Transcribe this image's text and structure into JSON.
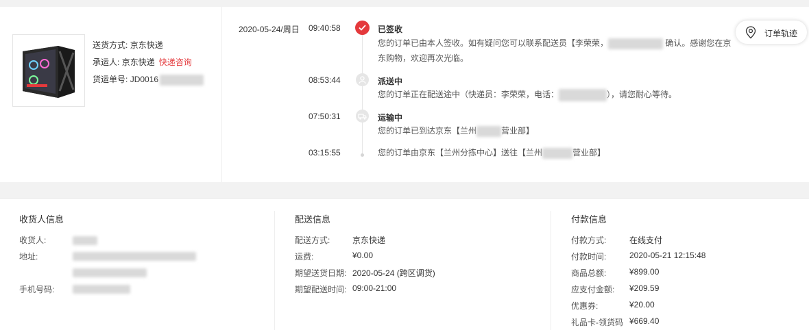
{
  "shipment": {
    "method_label": "送货方式:",
    "method_value": "京东快递",
    "carrier_label": "承运人:",
    "carrier_value": "京东快递",
    "carrier_link": "快递咨询",
    "tracking_label": "货运单号:",
    "tracking_value": "JD0016"
  },
  "timeline": {
    "date": "2020-05-24/周日",
    "events": [
      {
        "time": "09:40:58",
        "title": "已签收",
        "desc_1": "您的订单已由本人签收。如有疑问您可以联系配送员【李荣荣，",
        "desc_2": "确认。感谢您在京",
        "desc_3": "东购物，欢迎再次光临。"
      },
      {
        "time": "08:53:44",
        "title": "派送中",
        "desc_1": "您的订单正在配送途中（快递员：李荣荣，电话：",
        "desc_2": "），请您耐心等待。"
      },
      {
        "time": "07:50:31",
        "title": "运输中",
        "desc_1": "您的订单已到达京东【兰州",
        "desc_2": "营业部】"
      },
      {
        "time": "03:15:55",
        "desc_1": "您的订单由京东【兰州分拣中心】送往【兰州",
        "desc_2": "营业部】"
      }
    ],
    "track_button": "订单轨迹"
  },
  "receiver": {
    "title": "收货人信息",
    "name_label": "收货人:",
    "address_label": "地址:",
    "phone_label": "手机号码:"
  },
  "delivery": {
    "title": "配送信息",
    "rows": [
      {
        "label": "配送方式:",
        "value": "京东快递"
      },
      {
        "label": "运费:",
        "value": "¥0.00"
      },
      {
        "label": "期望送货日期:",
        "value": "2020-05-24 (跨区调货)"
      },
      {
        "label": "期望配送时间:",
        "value": "09:00-21:00"
      }
    ]
  },
  "payment": {
    "title": "付款信息",
    "rows": [
      {
        "label": "付款方式:",
        "value": "在线支付"
      },
      {
        "label": "付款时间:",
        "value": "2020-05-21 12:15:48"
      },
      {
        "label": "商品总额:",
        "value": "¥899.00"
      },
      {
        "label": "应支付金额:",
        "value": "¥209.59"
      },
      {
        "label": "优惠券:",
        "value": "¥20.00"
      },
      {
        "label": "礼品卡-领货码",
        "value": "¥669.40"
      }
    ]
  },
  "colors": {
    "accent": "#e4393c",
    "gray_dot": "#e6e6e6"
  }
}
